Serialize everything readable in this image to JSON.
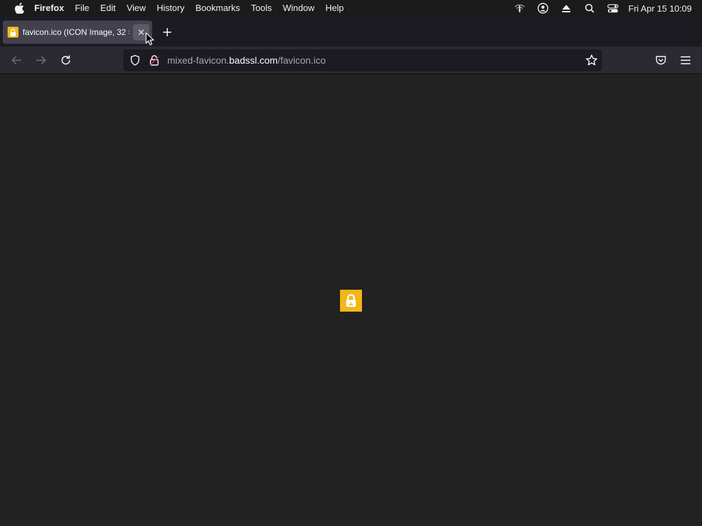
{
  "menubar": {
    "app_name": "Firefox",
    "menus": [
      "File",
      "Edit",
      "View",
      "History",
      "Bookmarks",
      "Tools",
      "Window",
      "Help"
    ],
    "clock": "Fri Apr 15  10:09",
    "status_icons": [
      "wifi-icon",
      "user-icon",
      "eject-icon",
      "spotlight-search-icon",
      "control-center-icon"
    ]
  },
  "tabs": [
    {
      "title": "favicon.ico (ICON Image, 32 ×",
      "favicon": "lock-favicon-icon",
      "active": true
    }
  ],
  "toolbar": {
    "url_prefix": "mixed-favicon.",
    "url_host": "badssl.com",
    "url_path": "/favicon.ico"
  },
  "content": {
    "displayed_image": "lock-favicon-icon",
    "background": "#222222"
  },
  "colors": {
    "favicon_yellow": "#f2b618",
    "tab_active": "#42414d",
    "url_field": "#1c1b22"
  }
}
